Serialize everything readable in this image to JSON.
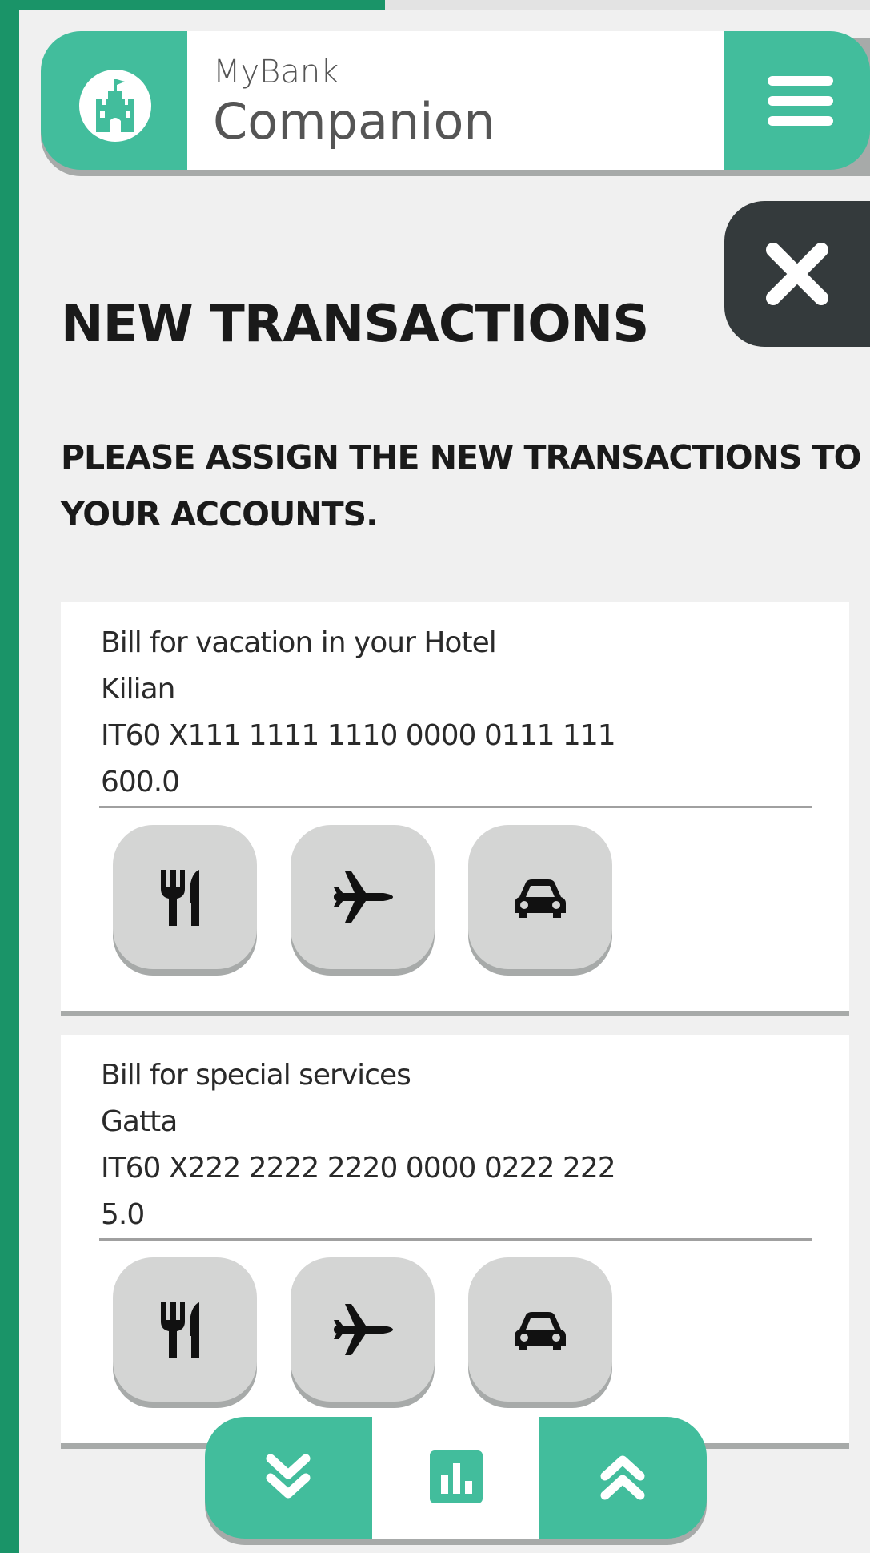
{
  "app": {
    "brand_small": "MyBank",
    "brand_large": "Companion"
  },
  "colors": {
    "accent": "#42bd9c",
    "accent_dark": "#1a9468",
    "close_bg": "#343a3c",
    "button_bg": "#d4d5d4",
    "page_bg": "#f0f0f0"
  },
  "progress": {
    "fraction": 0.43
  },
  "icons": {
    "logo": "castle-icon",
    "menu": "hamburger-menu-icon",
    "close": "close-icon",
    "categories": [
      "restaurant-icon",
      "airplane-icon",
      "car-icon"
    ],
    "nav": [
      "chevron-double-down-icon",
      "bar-chart-icon",
      "chevron-double-up-icon"
    ]
  },
  "page": {
    "title": "NEW TRANSACTIONS",
    "subtitle": "PLEASE ASSIGN THE NEW TRANSACTIONS TO YOUR ACCOUNTS."
  },
  "transactions": [
    {
      "description": "Bill for vacation in your Hotel",
      "counterparty": "Kilian",
      "iban": "IT60 X111 1111 1110 0000 0111 111",
      "amount": "600.0"
    },
    {
      "description": "Bill for special services",
      "counterparty": "Gatta",
      "iban": "IT60 X222 2222 2220 0000 0222 222",
      "amount": "5.0"
    }
  ]
}
